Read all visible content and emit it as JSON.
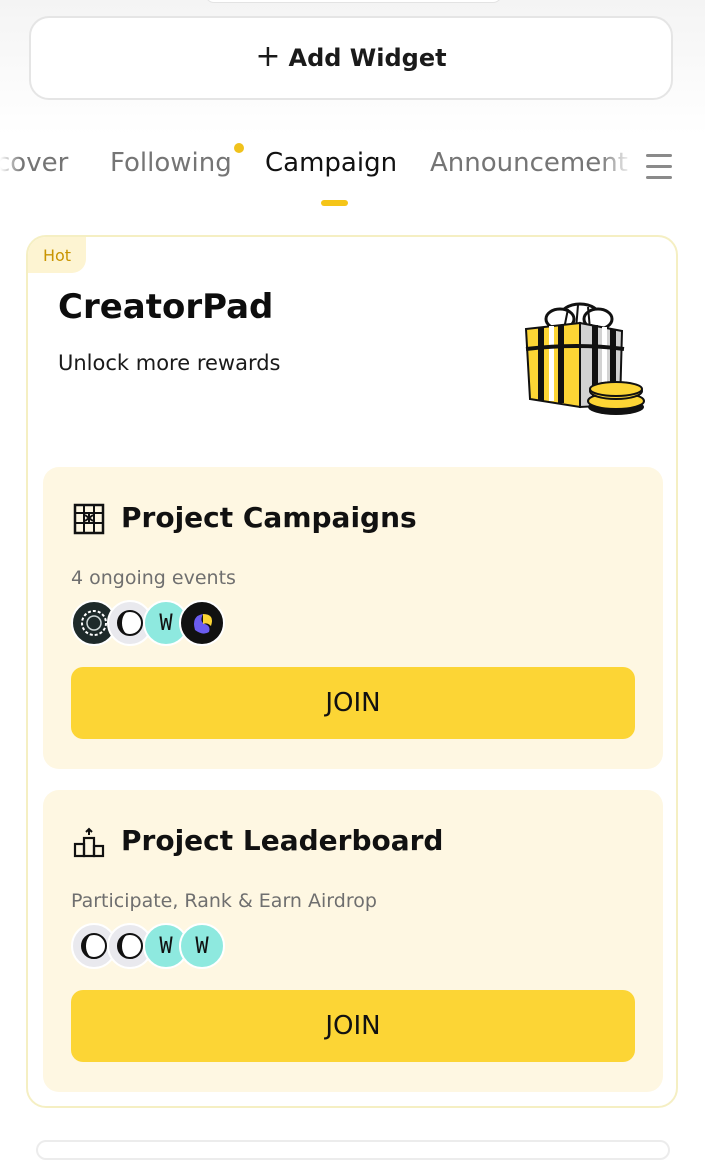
{
  "widget": {
    "add_label": "Add Widget",
    "icon": "plus-icon"
  },
  "tabs": [
    {
      "label": "cover",
      "active": false
    },
    {
      "label": "Following",
      "active": false,
      "has_dot": true
    },
    {
      "label": "Campaign",
      "active": true
    },
    {
      "label": "Announcement",
      "active": false
    }
  ],
  "card": {
    "badge": "Hot",
    "title": "CreatorPad",
    "subtitle": "Unlock more rewards",
    "illustration": "gift-icon"
  },
  "sections": [
    {
      "title": "Project Campaigns",
      "icon": "calendar-grid-icon",
      "description": "4 ongoing events",
      "avatars": [
        "spiral-token",
        "moon-token",
        "w-token",
        "swirl-token"
      ],
      "button": "JOIN"
    },
    {
      "title": "Project Leaderboard",
      "icon": "podium-icon",
      "description": "Participate, Rank & Earn Airdrop",
      "avatars": [
        "moon-token",
        "moon-token",
        "w-token",
        "w-token"
      ],
      "button": "JOIN"
    }
  ],
  "colors": {
    "accent": "#FCD535",
    "dot": "#F0C21C",
    "section_bg": "#FEF7E2",
    "badge_text": "#C99400"
  }
}
